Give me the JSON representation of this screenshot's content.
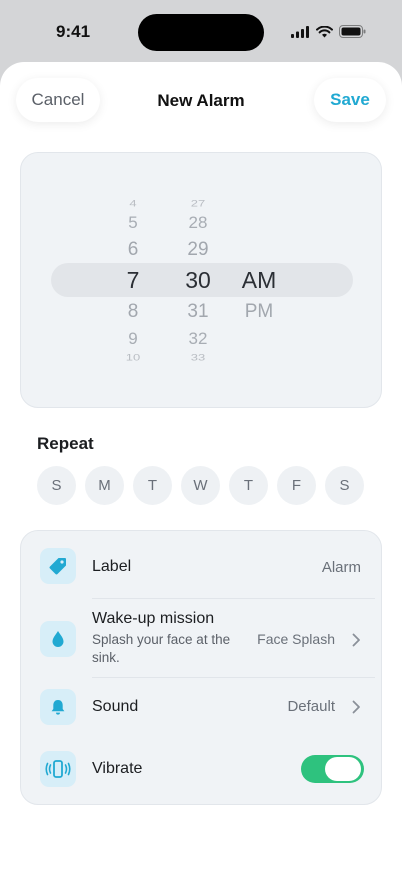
{
  "status": {
    "time": "9:41"
  },
  "nav": {
    "cancel_label": "Cancel",
    "title": "New Alarm",
    "save_label": "Save"
  },
  "picker": {
    "hours": [
      "4",
      "5",
      "6",
      "7",
      "8",
      "9",
      "10"
    ],
    "minutes": [
      "27",
      "28",
      "29",
      "30",
      "31",
      "32",
      "33"
    ],
    "periods": [
      "AM",
      "PM"
    ],
    "selected": {
      "hour": "7",
      "minute": "30",
      "period": "AM"
    }
  },
  "repeat": {
    "label": "Repeat",
    "days": [
      "S",
      "M",
      "T",
      "W",
      "T",
      "F",
      "S"
    ]
  },
  "settings": {
    "label": {
      "title": "Label",
      "value": "Alarm",
      "icon": "tag-icon"
    },
    "mission": {
      "title": "Wake-up mission",
      "subtitle": "Splash your face at the sink.",
      "value": "Face Splash",
      "icon": "water-drop-icon"
    },
    "sound": {
      "title": "Sound",
      "value": "Default",
      "icon": "bell-icon"
    },
    "vibrate": {
      "title": "Vibrate",
      "enabled": true,
      "icon": "phone-vibrate-icon"
    }
  },
  "colors": {
    "accent": "#21a9d2",
    "toggle_on": "#2ec27e",
    "icon_bg": "#d7eef8"
  }
}
